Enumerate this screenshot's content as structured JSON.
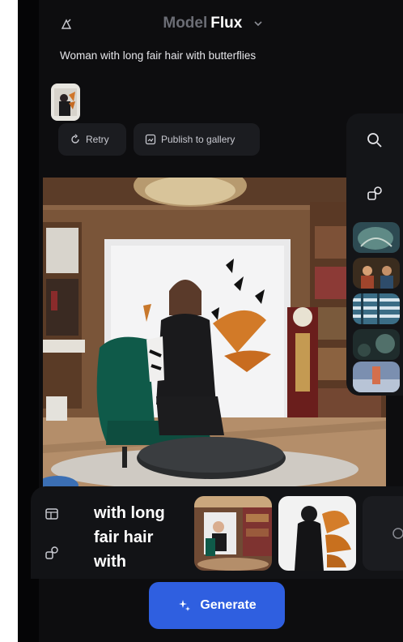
{
  "header": {
    "model_label": "Model",
    "model_name": "Flux"
  },
  "prompt": {
    "text": "Woman with long fair hair with butterflies"
  },
  "actions": {
    "retry_label": "Retry",
    "publish_label": "Publish to gallery"
  },
  "composer": {
    "prompt_preview": "with long fair hair with"
  },
  "generate": {
    "label": "Generate"
  },
  "colors": {
    "background": "#0d0d0f",
    "accent": "#2f5fe0",
    "chip": "#1b1c20"
  },
  "icons": {
    "model": "model-sparkle-icon",
    "chevron": "chevron-down-icon",
    "retry": "retry-icon",
    "publish": "publish-icon",
    "search": "search-icon",
    "shapes": "shapes-icon",
    "layout": "layout-icon",
    "shapes_alt": "shapes-icon",
    "generate": "sparkle-icon"
  }
}
